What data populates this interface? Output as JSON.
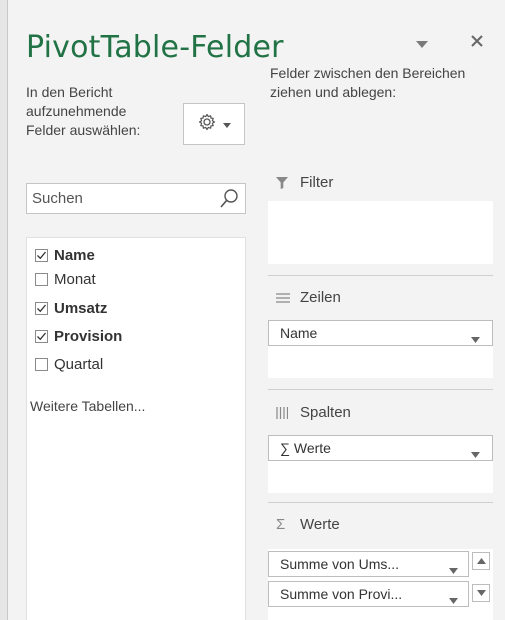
{
  "pane": {
    "title": "PivotTable-Felder",
    "left_description": "In den Bericht aufzunehmende Felder auswählen:",
    "right_description": "Felder zwischen den Bereichen ziehen und ablegen:",
    "search_placeholder": "Suchen",
    "fields": [
      {
        "label": "Name",
        "checked": true
      },
      {
        "label": "Monat",
        "checked": false
      },
      {
        "label": "Umsatz",
        "checked": true
      },
      {
        "label": "Provision",
        "checked": true
      },
      {
        "label": "Quartal",
        "checked": false
      }
    ],
    "more_tables": "Weitere Tabellen...",
    "areas": {
      "filter": {
        "label": "Filter"
      },
      "rows": {
        "label": "Zeilen",
        "items": [
          "Name"
        ]
      },
      "columns": {
        "label": "Spalten",
        "items": [
          "∑ Werte"
        ]
      },
      "values": {
        "label": "Werte",
        "items": [
          "Summe von Ums...",
          "Summe von Provi..."
        ]
      }
    }
  },
  "colors": {
    "title": "#217346",
    "checkmark": "#333333"
  }
}
